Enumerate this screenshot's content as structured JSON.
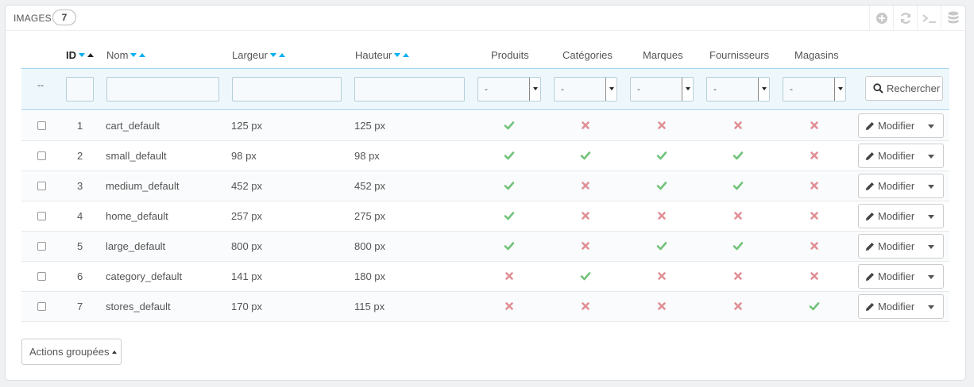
{
  "panel": {
    "title": "IMAGES",
    "count": "7"
  },
  "toolbar": [
    {
      "icon": "add-icon"
    },
    {
      "icon": "refresh-icon"
    },
    {
      "icon": "terminal-icon"
    },
    {
      "icon": "database-icon"
    }
  ],
  "columns": {
    "id": "ID",
    "name": "Nom",
    "width": "Largeur",
    "height": "Hauteur",
    "products": "Produits",
    "categories": "Catégories",
    "manufacturers": "Marques",
    "suppliers": "Fournisseurs",
    "stores": "Magasins"
  },
  "filters": {
    "dashes": "--",
    "select_value": "-",
    "search_label": "Rechercher"
  },
  "rows": [
    {
      "id": "1",
      "name": "cart_default",
      "width": "125 px",
      "height": "125 px",
      "products": true,
      "categories": false,
      "manufacturers": false,
      "suppliers": false,
      "stores": false
    },
    {
      "id": "2",
      "name": "small_default",
      "width": "98 px",
      "height": "98 px",
      "products": true,
      "categories": true,
      "manufacturers": true,
      "suppliers": true,
      "stores": false
    },
    {
      "id": "3",
      "name": "medium_default",
      "width": "452 px",
      "height": "452 px",
      "products": true,
      "categories": false,
      "manufacturers": true,
      "suppliers": true,
      "stores": false
    },
    {
      "id": "4",
      "name": "home_default",
      "width": "257 px",
      "height": "275 px",
      "products": true,
      "categories": false,
      "manufacturers": false,
      "suppliers": false,
      "stores": false
    },
    {
      "id": "5",
      "name": "large_default",
      "width": "800 px",
      "height": "800 px",
      "products": true,
      "categories": false,
      "manufacturers": true,
      "suppliers": true,
      "stores": false
    },
    {
      "id": "6",
      "name": "category_default",
      "width": "141 px",
      "height": "180 px",
      "products": false,
      "categories": true,
      "manufacturers": false,
      "suppliers": false,
      "stores": false
    },
    {
      "id": "7",
      "name": "stores_default",
      "width": "170 px",
      "height": "115 px",
      "products": false,
      "categories": false,
      "manufacturers": false,
      "suppliers": false,
      "stores": true
    }
  ],
  "row_action": {
    "label": "Modifier",
    "icon": "pencil-icon"
  },
  "bulk": {
    "label": "Actions groupées"
  },
  "colors": {
    "yes": "#72c279",
    "no": "#e08f95",
    "accent": "#00aff0",
    "filter_bg": "#eef7fb"
  }
}
